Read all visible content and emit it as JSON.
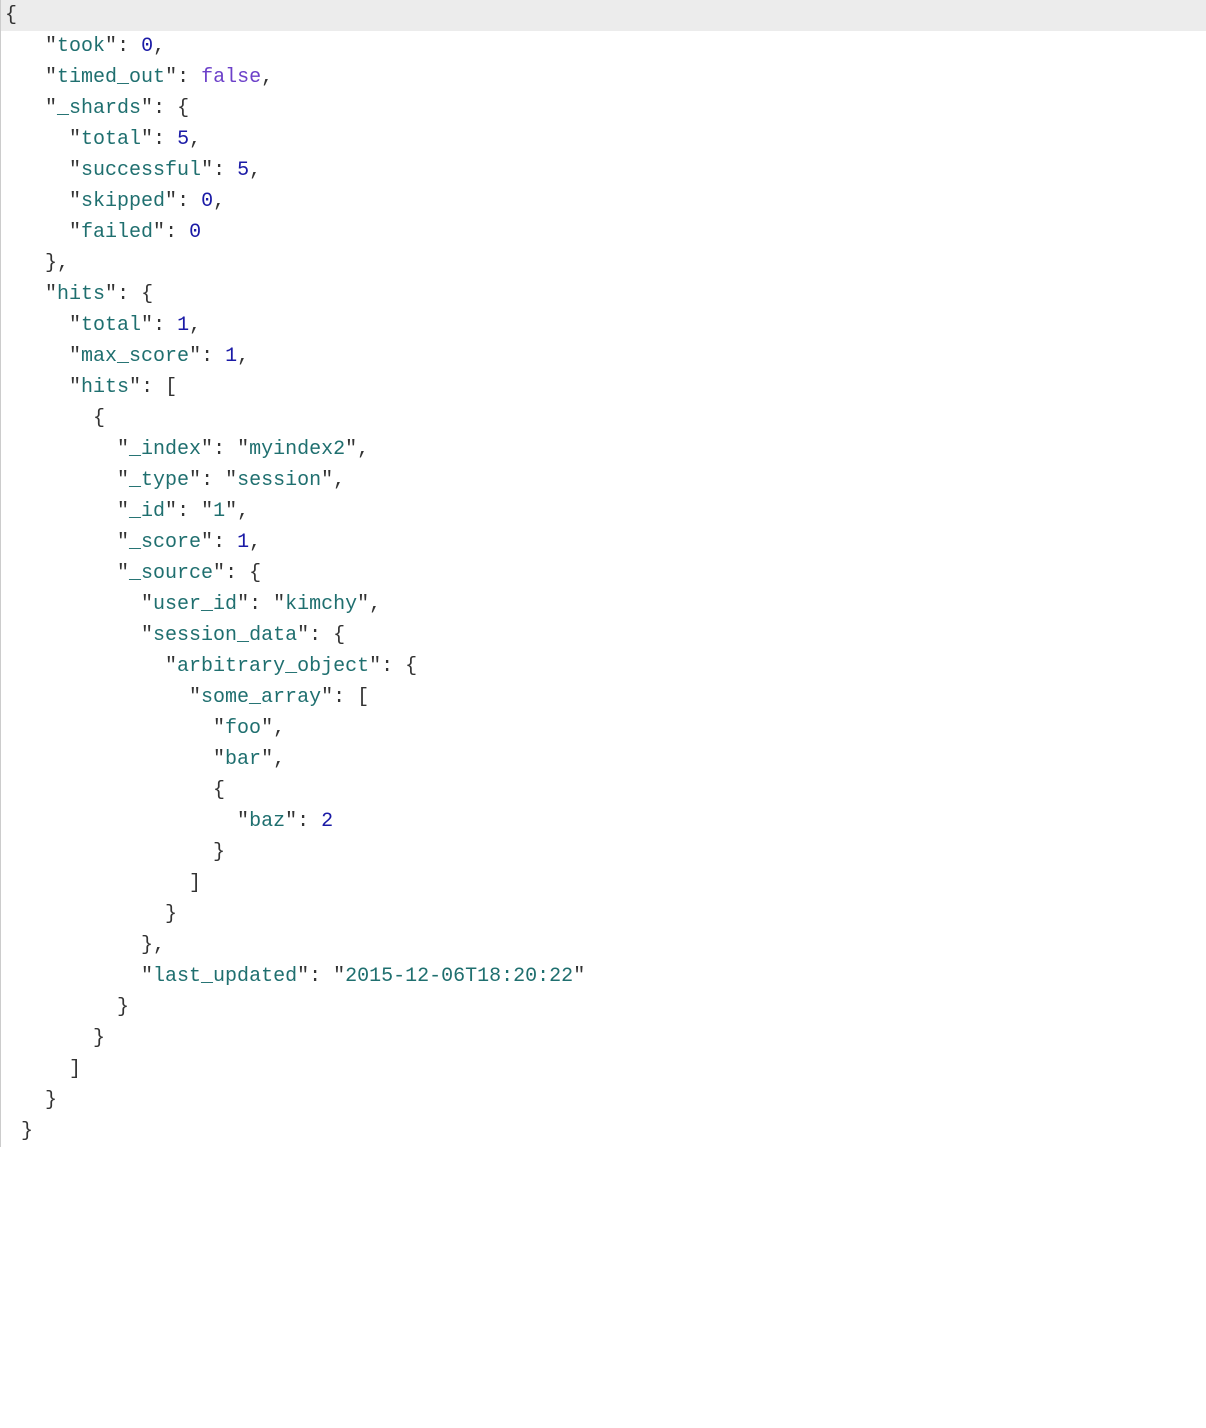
{
  "json_response": {
    "took": 0,
    "timed_out": false,
    "_shards": {
      "total": 5,
      "successful": 5,
      "skipped": 0,
      "failed": 0
    },
    "hits": {
      "total": 1,
      "max_score": 1,
      "hits": [
        {
          "_index": "myindex2",
          "_type": "session",
          "_id": "1",
          "_score": 1,
          "_source": {
            "user_id": "kimchy",
            "session_data": {
              "arbitrary_object": {
                "some_array": [
                  "foo",
                  "bar",
                  {
                    "baz": 2
                  }
                ]
              }
            },
            "last_updated": "2015-12-06T18:20:22"
          }
        }
      ]
    }
  },
  "keys": {
    "took": "took",
    "timed_out": "timed_out",
    "_shards": "_shards",
    "total": "total",
    "successful": "successful",
    "skipped": "skipped",
    "failed": "failed",
    "hits": "hits",
    "max_score": "max_score",
    "_index": "_index",
    "_type": "_type",
    "_id": "_id",
    "_score": "_score",
    "_source": "_source",
    "user_id": "user_id",
    "session_data": "session_data",
    "arbitrary_object": "arbitrary_object",
    "some_array": "some_array",
    "baz": "baz",
    "last_updated": "last_updated"
  },
  "values": {
    "took": "0",
    "timed_out": "false",
    "shards_total": "5",
    "shards_successful": "5",
    "shards_skipped": "0",
    "shards_failed": "0",
    "hits_total": "1",
    "hits_max_score": "1",
    "hit0_index": "myindex2",
    "hit0_type": "session",
    "hit0_id": "1",
    "hit0_score": "1",
    "src_user_id": "kimchy",
    "arr0": "foo",
    "arr1": "bar",
    "baz": "2",
    "last_updated": "2015-12-06T18:20:22"
  },
  "glyphs": {
    "lbrace": "{",
    "rbrace": "}",
    "lbracket": "[",
    "rbracket": "]",
    "colon": ":",
    "comma": ",",
    "quote": "\""
  }
}
